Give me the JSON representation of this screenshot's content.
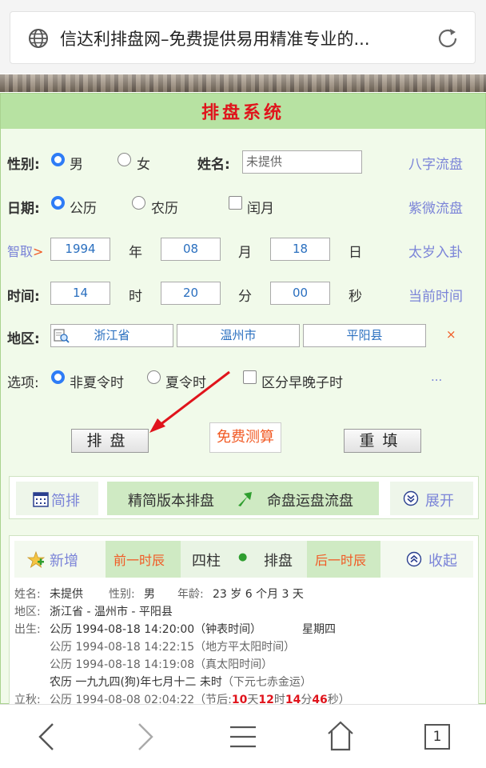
{
  "browser": {
    "tab_title": "信达利排盘网–免费提供易用精准专业的...",
    "tab_count": "1"
  },
  "panel": {
    "title": "排盘系统"
  },
  "form": {
    "gender_label": "性别:",
    "male": "男",
    "female": "女",
    "name_label": "姓名:",
    "name_value": "未提供",
    "link_bazi": "八字流盘",
    "date_label": "日期:",
    "solar": "公历",
    "lunar": "农历",
    "leap": "闰月",
    "link_ziwei": "紫微流盘",
    "smart_fetch": "智取",
    "smart_arrow": ">",
    "year_value": "1994",
    "year_unit": "年",
    "month_value": "08",
    "month_unit": "月",
    "day_value": "18",
    "day_unit": "日",
    "link_taisui": "太岁入卦",
    "time_label": "时间:",
    "hour_value": "14",
    "hour_unit": "时",
    "minute_value": "20",
    "minute_unit": "分",
    "second_value": "00",
    "second_unit": "秒",
    "link_now": "当前时间",
    "region_label": "地区:",
    "province": "浙江省",
    "city": "温州市",
    "county": "平阳县",
    "clear_mark": "×",
    "options_label": "选项:",
    "no_dst": "非夏令时",
    "dst": "夏令时",
    "zi_hour": "区分早晚子时",
    "more": "...",
    "btn_paipan": "排盘",
    "btn_free": "免费测算",
    "btn_reset": "重填"
  },
  "toolbar1": {
    "simple": "简排",
    "lite": "精简版本排盘",
    "fate": "命盘运盘流盘",
    "expand": "展开"
  },
  "toolbar2": {
    "add": "新增",
    "prev": "前一时辰",
    "four_pillars": "四柱",
    "dot": "●",
    "paipan": "排盘",
    "next": "后一时辰",
    "collapse": "收起"
  },
  "result": {
    "name_key": "姓名:",
    "name_val": "未提供",
    "gender_key": "性别:",
    "gender_val": "男",
    "age_key": "年龄:",
    "age_val": "23 岁 6 个月 3 天",
    "region_key": "地区:",
    "region_val": "浙江省 - 温州市 - 平阳县",
    "birth_key": "出生:",
    "birth_line1": "公历 1994-08-18 14:20:00（钟表时间）",
    "weekday": "星期四",
    "birth_line2": "公历 1994-08-18 14:22:15（地方平太阳时间）",
    "birth_line3": "公历 1994-08-18 14:19:08（真太阳时间）",
    "lunar_line_main": "农历 一九九四(狗)年七月十二 未时",
    "lunar_line_note": "（下元七赤金运）",
    "liqiu_key": "立秋:",
    "liqiu_prefix": "公历 1994-08-08 02:04:22（节后:",
    "d_num": "10",
    "d_unit": "天",
    "h_num": "12",
    "h_unit": "时",
    "m_num": "14",
    "m_unit": "分",
    "s_num": "46",
    "s_unit": "秒",
    "liqiu_suffix": "）"
  },
  "colors": {
    "accent_red": "#e0141c",
    "link_blue": "#7b84d8",
    "panel_green": "#b7e2a2",
    "radio_blue": "#2e7cf6",
    "orange": "#f15a24"
  }
}
